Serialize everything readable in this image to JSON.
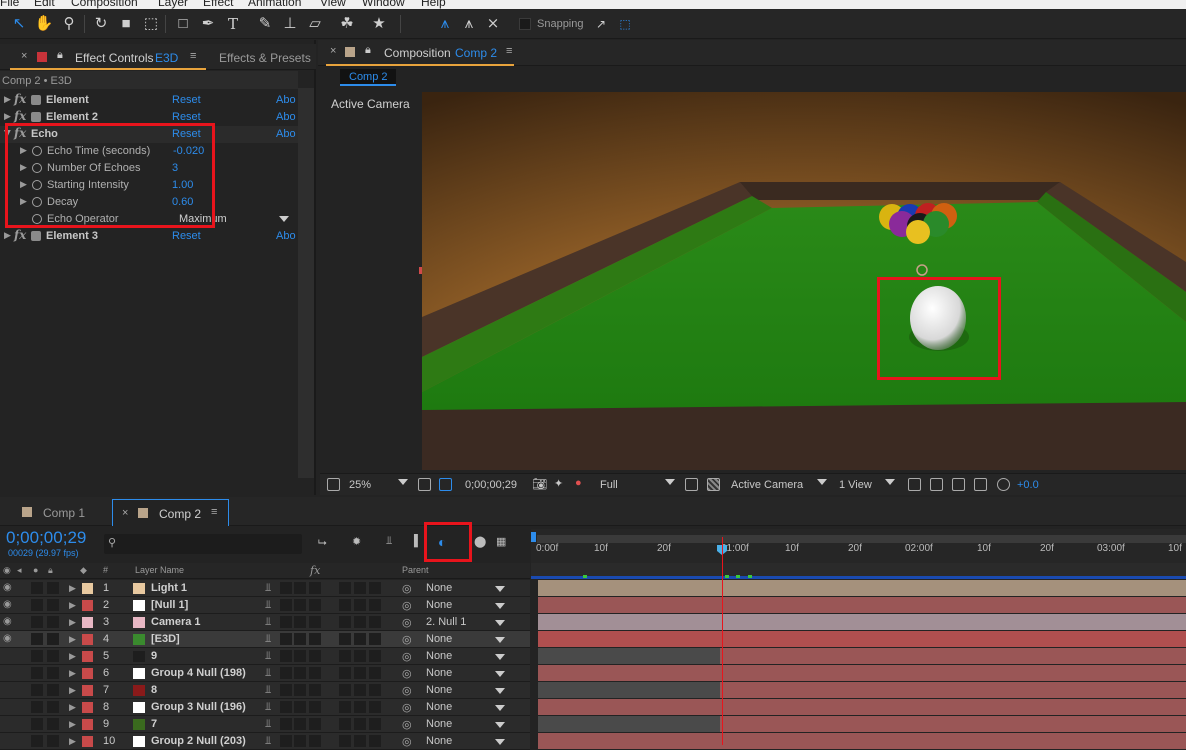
{
  "menubar": {
    "items": [
      "File",
      "Edit",
      "Composition",
      "Layer",
      "Effect",
      "Animation",
      "View",
      "Window",
      "Help"
    ]
  },
  "toolbar": {
    "snapping_label": "Snapping"
  },
  "effect_controls": {
    "panel_title": "Effect Controls",
    "layer_tag": "E3D",
    "other_tab": "Effects & Presets",
    "breadcrumb": "Comp 2 • E3D",
    "effects": [
      {
        "name": "Element",
        "reset": "Reset",
        "about": "Abo"
      },
      {
        "name": "Element 2",
        "reset": "Reset",
        "about": "Abo"
      },
      {
        "name": "Echo",
        "reset": "Reset",
        "about": "Abo"
      },
      {
        "name": "Element 3",
        "reset": "Reset",
        "about": "Abo"
      }
    ],
    "echo_params": [
      {
        "label": "Echo Time (seconds)",
        "value": "-0.020"
      },
      {
        "label": "Number Of Echoes",
        "value": "3"
      },
      {
        "label": "Starting Intensity",
        "value": "1.00"
      },
      {
        "label": "Decay",
        "value": "0.60"
      },
      {
        "label": "Echo Operator",
        "value": "Maximum"
      }
    ]
  },
  "composition": {
    "panel_title": "Composition",
    "comp_name": "Comp 2",
    "sub_tab": "Comp 2",
    "view_label": "Active Camera",
    "bottom_bar": {
      "zoom": "25%",
      "timecode": "0;00;00;29",
      "resolution": "Full",
      "camera": "Active Camera",
      "views": "1 View",
      "exposure": "+0.0"
    }
  },
  "timeline": {
    "tabs": [
      "Comp 1",
      "Comp 2"
    ],
    "timecode": "0;00;00;29",
    "frame_info": "00029 (29.97 fps)",
    "search_placeholder": "",
    "columns": {
      "num": "#",
      "layer_name": "Layer Name",
      "fx": "fx",
      "parent": "Parent"
    },
    "ruler": [
      "0:00f",
      "10f",
      "20f",
      "01:00f",
      "10f",
      "20f",
      "02:00f",
      "10f",
      "20f",
      "03:00f",
      "10f"
    ],
    "layers": [
      {
        "num": "1",
        "name": "Light 1",
        "color": "#e8c9a0",
        "parent": "None",
        "label_color": "#e8c9a0",
        "bar": "#a5917c"
      },
      {
        "num": "2",
        "name": "[Null 1]",
        "color": "#ffffff",
        "parent": "None",
        "label_color": "#c84a4a",
        "bar": "#9a5656"
      },
      {
        "num": "3",
        "name": "Camera 1",
        "color": "#e8b7c4",
        "parent": "2. Null 1",
        "label_color": "#e8b7c4",
        "bar": "#a28f96"
      },
      {
        "num": "4",
        "name": "[E3D]",
        "color": "#3a8a2e",
        "parent": "None",
        "label_color": "#c84a4a",
        "bar": "#b04f4f"
      },
      {
        "num": "5",
        "name": "9",
        "color": "#1e1e1e",
        "parent": "None",
        "label_color": "#c84a4a",
        "bar": "#9a5656"
      },
      {
        "num": "6",
        "name": "Group 4 Null (198)",
        "color": "#ffffff",
        "parent": "None",
        "label_color": "#c84a4a",
        "bar": "#9a5656"
      },
      {
        "num": "7",
        "name": "8",
        "color": "#8a1a1a",
        "parent": "None",
        "label_color": "#c84a4a",
        "bar": "#9a5656"
      },
      {
        "num": "8",
        "name": "Group 3 Null (196)",
        "color": "#ffffff",
        "parent": "None",
        "label_color": "#c84a4a",
        "bar": "#9a5656"
      },
      {
        "num": "9",
        "name": "7",
        "color": "#3a6a1e",
        "parent": "None",
        "label_color": "#c84a4a",
        "bar": "#9a5656"
      },
      {
        "num": "10",
        "name": "Group 2 Null (203)",
        "color": "#ffffff",
        "parent": "None",
        "label_color": "#c84a4a",
        "bar": "#9a5656"
      }
    ]
  },
  "colors": {
    "accent_blue": "#2d8ceb",
    "highlight_red": "#e8141c",
    "playhead": "#e8141c"
  }
}
